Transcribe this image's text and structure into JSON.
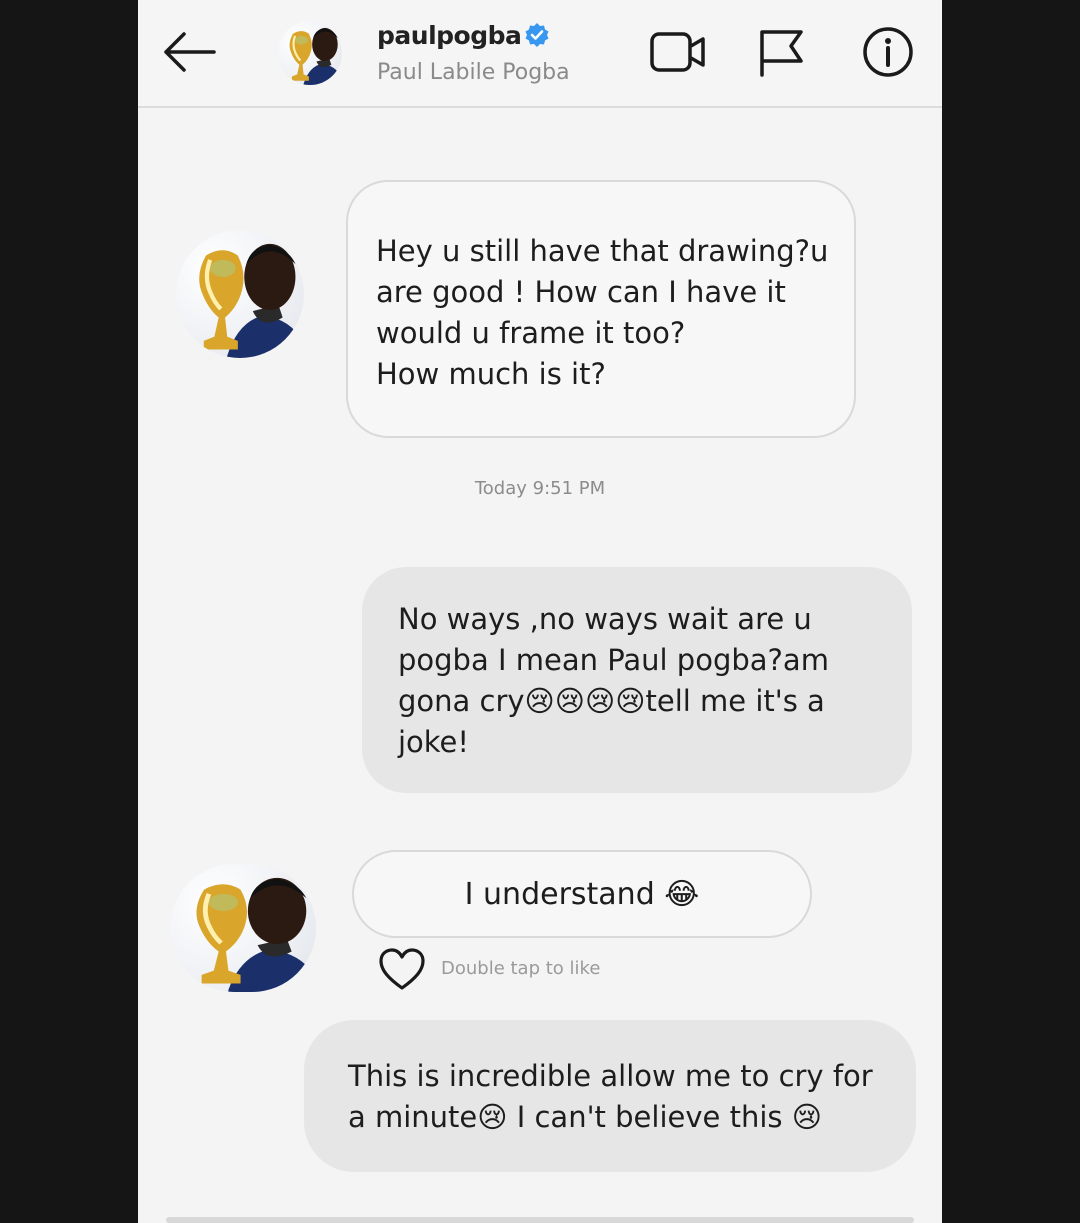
{
  "header": {
    "handle": "paulpogba",
    "full_name": "Paul Labile Pogba"
  },
  "messages": [
    {
      "direction": "incoming",
      "text": "Hey u still have that drawing?u are good ! How can I have it would u frame it too?\nHow much is it?"
    },
    {
      "direction": "outgoing",
      "text": "No ways ,no ways wait are u pogba I mean Paul pogba?am gona cry😢😢😢😢tell me it's a joke!"
    },
    {
      "direction": "incoming",
      "text": "I understand 😂"
    },
    {
      "direction": "outgoing",
      "text": "This is incredible allow me to cry for a minute😢 I can't believe this 😢"
    }
  ],
  "timestamp": "Today 9:51 PM",
  "like_hint": "Double tap to like",
  "colors": {
    "verified_badge": "#3897f0",
    "incoming_bubble": "#f7f7f7",
    "outgoing_bubble": "#e6e6e6",
    "background": "#f4f4f4"
  },
  "icons": {
    "back": "arrow-left-icon",
    "video": "video-camera-icon",
    "report": "flag-icon",
    "info": "info-icon",
    "like": "heart-icon",
    "verified": "verified-badge-icon"
  }
}
